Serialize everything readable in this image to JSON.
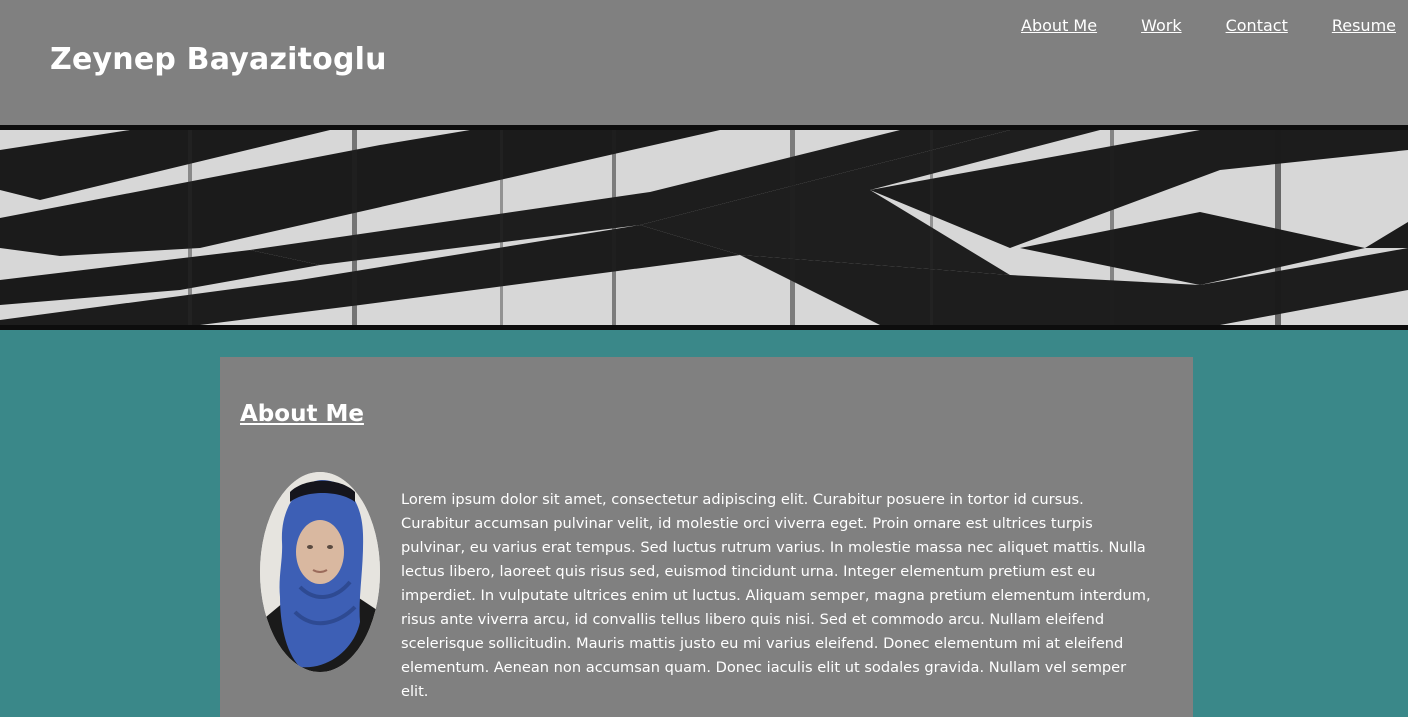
{
  "header": {
    "site_name": "Zeynep Bayazitoglu",
    "nav": [
      {
        "label": "About Me"
      },
      {
        "label": "Work"
      },
      {
        "label": "Contact"
      },
      {
        "label": "Resume"
      }
    ]
  },
  "banner": {
    "description_icon": "black-and-white-geometric-pattern"
  },
  "about": {
    "title": "About Me",
    "bio": "Lorem ipsum dolor sit amet, consectetur adipiscing elit. Curabitur posuere in tortor id cursus. Curabitur accumsan pulvinar velit, id molestie orci viverra eget. Proin ornare est ultrices turpis pulvinar, eu varius erat tempus. Sed luctus rutrum varius. In molestie massa nec aliquet mattis. Nulla lectus libero, laoreet quis risus sed, euismod tincidunt urna. Integer elementum pretium est eu imperdiet. In vulputate ultrices enim ut luctus. Aliquam semper, magna pretium elementum interdum, risus ante viverra arcu, id convallis tellus libero quis nisi. Sed et commodo arcu. Nullam eleifend scelerisque sollicitudin. Mauris mattis justo eu mi varius eleifend. Donec elementum mi at eleifend elementum. Aenean non accumsan quam. Donec iaculis elit ut sodales gravida. Nullam vel semper elit."
  },
  "colors": {
    "page_background": "#3a8889",
    "header_background": "#808080",
    "card_background": "#808080",
    "text": "#ffffff"
  }
}
